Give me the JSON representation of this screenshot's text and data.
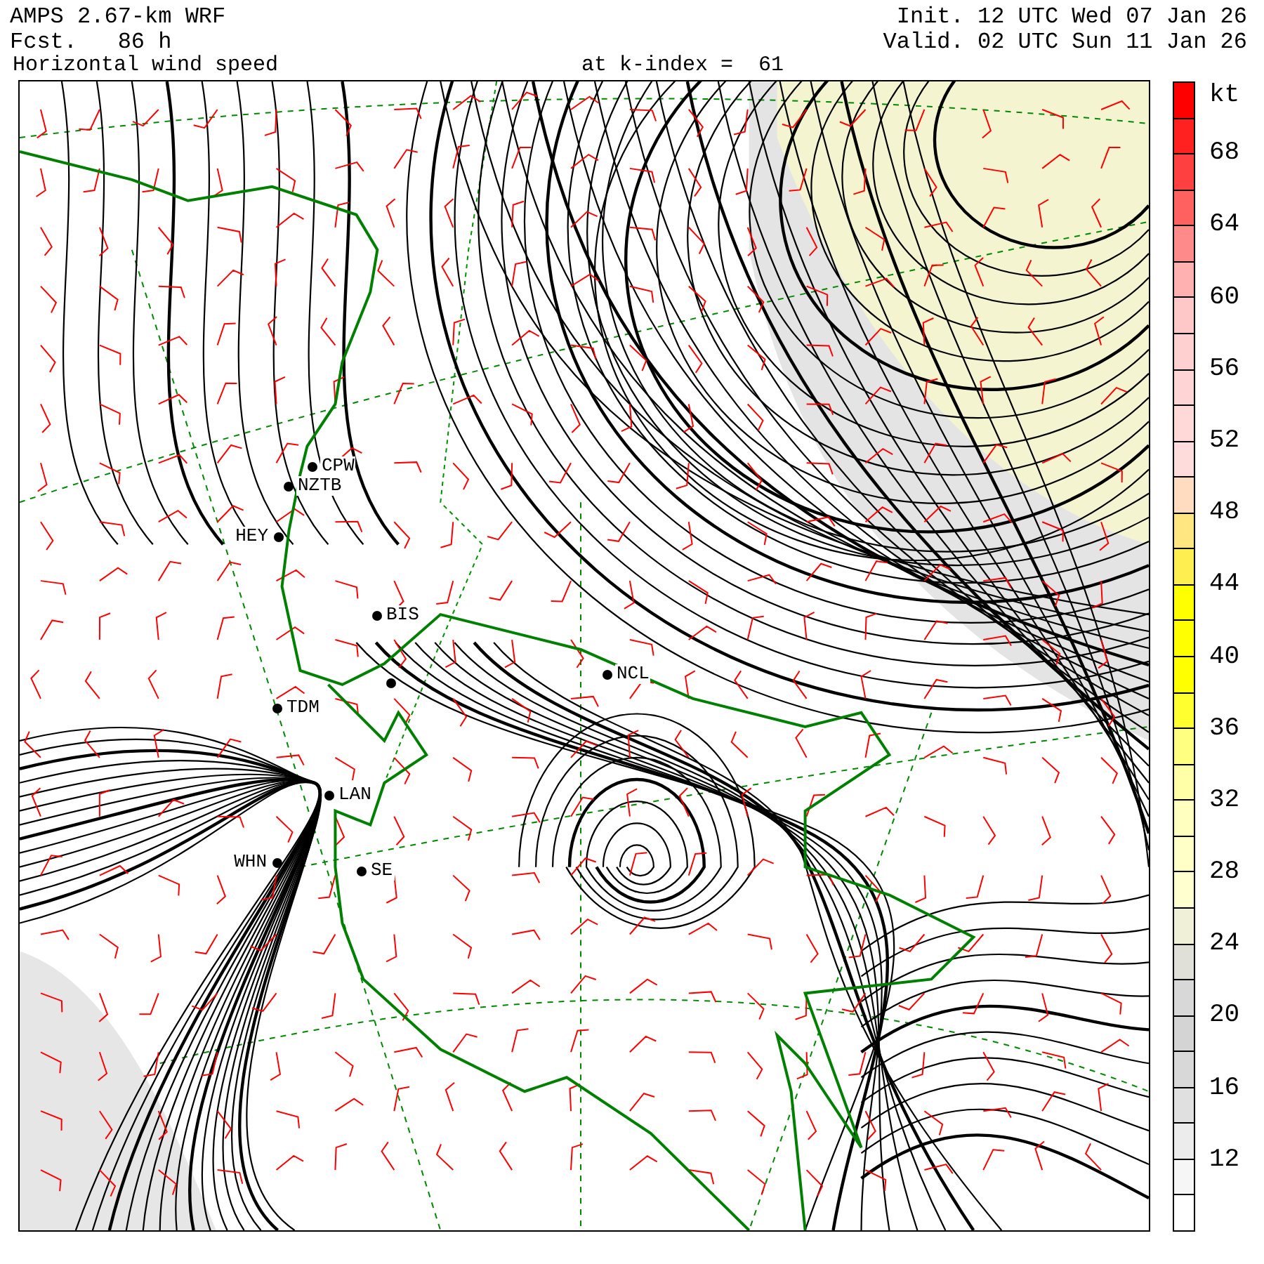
{
  "header": {
    "model": "AMPS 2.67-km WRF",
    "forecast": "Fcst.   86 h",
    "init": "Init. 12 UTC Wed 07 Jan 26",
    "valid": "Valid. 02 UTC Sun 11 Jan 26",
    "field": "Horizontal wind speed",
    "level": "at k-index =  61"
  },
  "stations": [
    {
      "label": "CPW"
    },
    {
      "label": "NZTB"
    },
    {
      "label": "HEY"
    },
    {
      "label": "BIS"
    },
    {
      "label": "NCL"
    },
    {
      "label": "TDM"
    },
    {
      "label": "LAN"
    },
    {
      "label": "WHN"
    },
    {
      "label": "SE"
    }
  ],
  "colorbar": {
    "unit": "kt",
    "labels": [
      "68",
      "64",
      "60",
      "56",
      "52",
      "48",
      "44",
      "40",
      "36",
      "32",
      "28",
      "24",
      "20",
      "16",
      "12"
    ],
    "boxes": [
      {
        "color": "#ff0000"
      },
      {
        "color": "#ff2020"
      },
      {
        "color": "#ff4040"
      },
      {
        "color": "#ff6060"
      },
      {
        "color": "#ff8a8a"
      },
      {
        "color": "#ffb0b0"
      },
      {
        "color": "#ffc8c8"
      },
      {
        "color": "#ffd0d0"
      },
      {
        "color": "#ffd4d4"
      },
      {
        "color": "#ffd8d8"
      },
      {
        "color": "#ffdcdc"
      },
      {
        "color": "#ffdcc0"
      },
      {
        "color": "#ffe680"
      },
      {
        "color": "#ffee50"
      },
      {
        "color": "#ffff00"
      },
      {
        "color": "#ffff00"
      },
      {
        "color": "#ffff00"
      },
      {
        "color": "#ffff30"
      },
      {
        "color": "#ffff80"
      },
      {
        "color": "#ffffa8"
      },
      {
        "color": "#ffffc0"
      },
      {
        "color": "#ffffc8"
      },
      {
        "color": "#ffffd0"
      },
      {
        "color": "#f0f0d8"
      },
      {
        "color": "#e0e0d8"
      },
      {
        "color": "#d8d8d8"
      },
      {
        "color": "#d4d4d4"
      },
      {
        "color": "#d8d8d8"
      },
      {
        "color": "#e0e0e0"
      },
      {
        "color": "#ececec"
      },
      {
        "color": "#f6f6f6"
      },
      {
        "color": "#ffffff"
      }
    ]
  }
}
